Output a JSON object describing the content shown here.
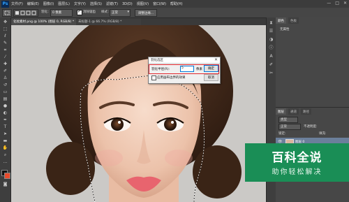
{
  "app": {
    "logo": "Ps",
    "menu": [
      "文件(F)",
      "编辑(E)",
      "图像(I)",
      "图层(L)",
      "文字(Y)",
      "选择(S)",
      "滤镜(T)",
      "3D(D)",
      "视图(V)",
      "窗口(W)",
      "帮助(H)"
    ],
    "window_controls": [
      "—",
      "□",
      "✕"
    ]
  },
  "options_bar": {
    "feather_label": "羽化：",
    "feather_value": "0 像素",
    "antialias_label": "消除锯齿",
    "style_label": "样式：",
    "style_value": "正常",
    "refine_edge_label": "调整边缘..."
  },
  "tabs": [
    {
      "label": "化妆素材.png @ 100% (图层 0, RGB/8) *",
      "active": true
    },
    {
      "label": "未标题-1 @ 66.7% (RGB/8) *",
      "active": false
    }
  ],
  "dialog": {
    "title": "羽化选区",
    "close": "✕",
    "feather_radius_label": "羽化半径(R):",
    "feather_radius_value": "5",
    "unit": "像素",
    "ok_label": "确定",
    "cancel_label": "取消",
    "apply_edge_label": "应用画布边界的效果",
    "apply_edge_checked": false,
    "highlight_color": "#e0262c"
  },
  "right_panels": {
    "top_tabs": [
      "颜色",
      "色板"
    ],
    "top_panel_text": "无属性",
    "layers_tabs": [
      "图层",
      "通道",
      "路径"
    ],
    "layer_kind": "类型",
    "layer_mode": "正常",
    "layer_opacity_label": "不透明度:",
    "lock_label": "锁定:",
    "fill_label": "填充:",
    "layers": [
      {
        "name": "图层 0",
        "selected": true
      }
    ]
  },
  "watermark": {
    "title": "百科全说",
    "subtitle": "助你轻松解决",
    "color": "#1a8e56"
  }
}
